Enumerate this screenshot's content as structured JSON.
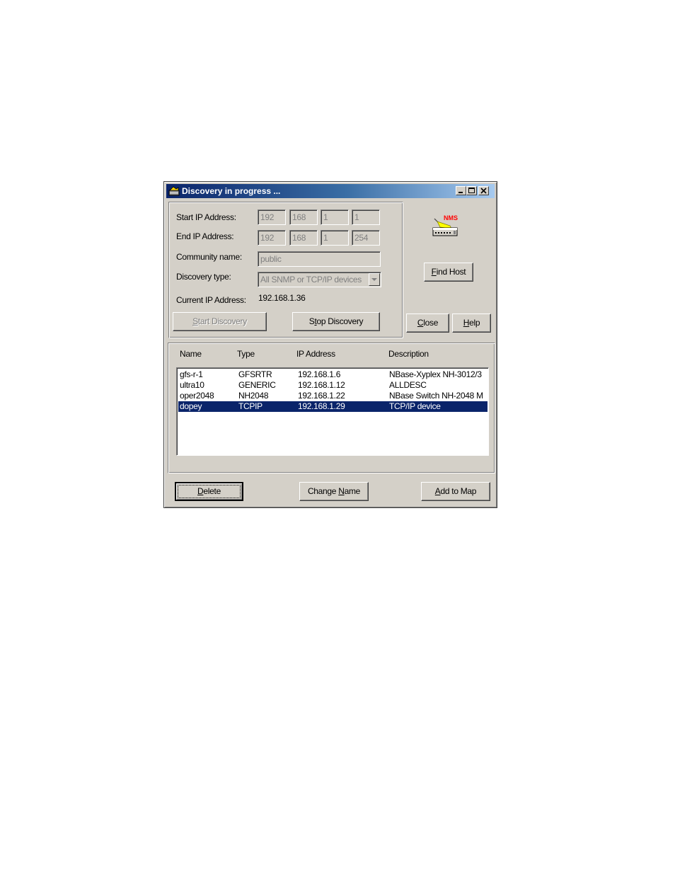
{
  "window": {
    "title": "Discovery in progress ...",
    "controls": {
      "minimize": "_",
      "maximize": "□",
      "close": "✕"
    }
  },
  "form": {
    "start_ip_label": "Start IP Address:",
    "start_ip": [
      "192",
      "168",
      "1",
      "1"
    ],
    "end_ip_label": "End IP Address:",
    "end_ip": [
      "192",
      "168",
      "1",
      "254"
    ],
    "community_label": "Community name:",
    "community_value": "public",
    "discovery_type_label": "Discovery type:",
    "discovery_type_value": "All SNMP or TCP/IP devices",
    "current_ip_label": "Current IP Address:",
    "current_ip_value": "192.168.1.36"
  },
  "buttons": {
    "start_discovery": {
      "u": "S",
      "rest": "tart Discovery"
    },
    "stop_discovery": {
      "pre": "S",
      "u": "t",
      "rest": "op Discovery"
    },
    "find_host": {
      "u": "F",
      "rest": "ind Host"
    },
    "close": {
      "u": "C",
      "rest": "lose"
    },
    "help": {
      "u": "H",
      "rest": "elp"
    },
    "delete": {
      "u": "D",
      "rest": "elete"
    },
    "change_name": {
      "pre": "Change ",
      "u": "N",
      "rest": "ame"
    },
    "add_to_map": {
      "u": "A",
      "rest": "dd to Map"
    }
  },
  "logo": {
    "text": "NMS",
    "icon": "nms-device-icon"
  },
  "list": {
    "columns": [
      "Name",
      "Type",
      "IP Address",
      "Description"
    ],
    "rows": [
      {
        "name": "gfs-r-1",
        "type": "GFSRTR",
        "ip": "192.168.1.6",
        "desc": "NBase-Xyplex NH-3012/3"
      },
      {
        "name": "ultra10",
        "type": "GENERIC",
        "ip": "192.168.1.12",
        "desc": "ALLDESC"
      },
      {
        "name": "oper2048",
        "type": "NH2048",
        "ip": "192.168.1.22",
        "desc": "NBase Switch NH-2048 M"
      },
      {
        "name": "dopey",
        "type": "TCPIP",
        "ip": "192.168.1.29",
        "desc": "TCP/IP device"
      }
    ],
    "selected_index": 3
  },
  "colors": {
    "titlebar": "#0a246a",
    "face": "#d4d0c8",
    "selection": "#0a246a",
    "logo_text": "#ff0000"
  }
}
